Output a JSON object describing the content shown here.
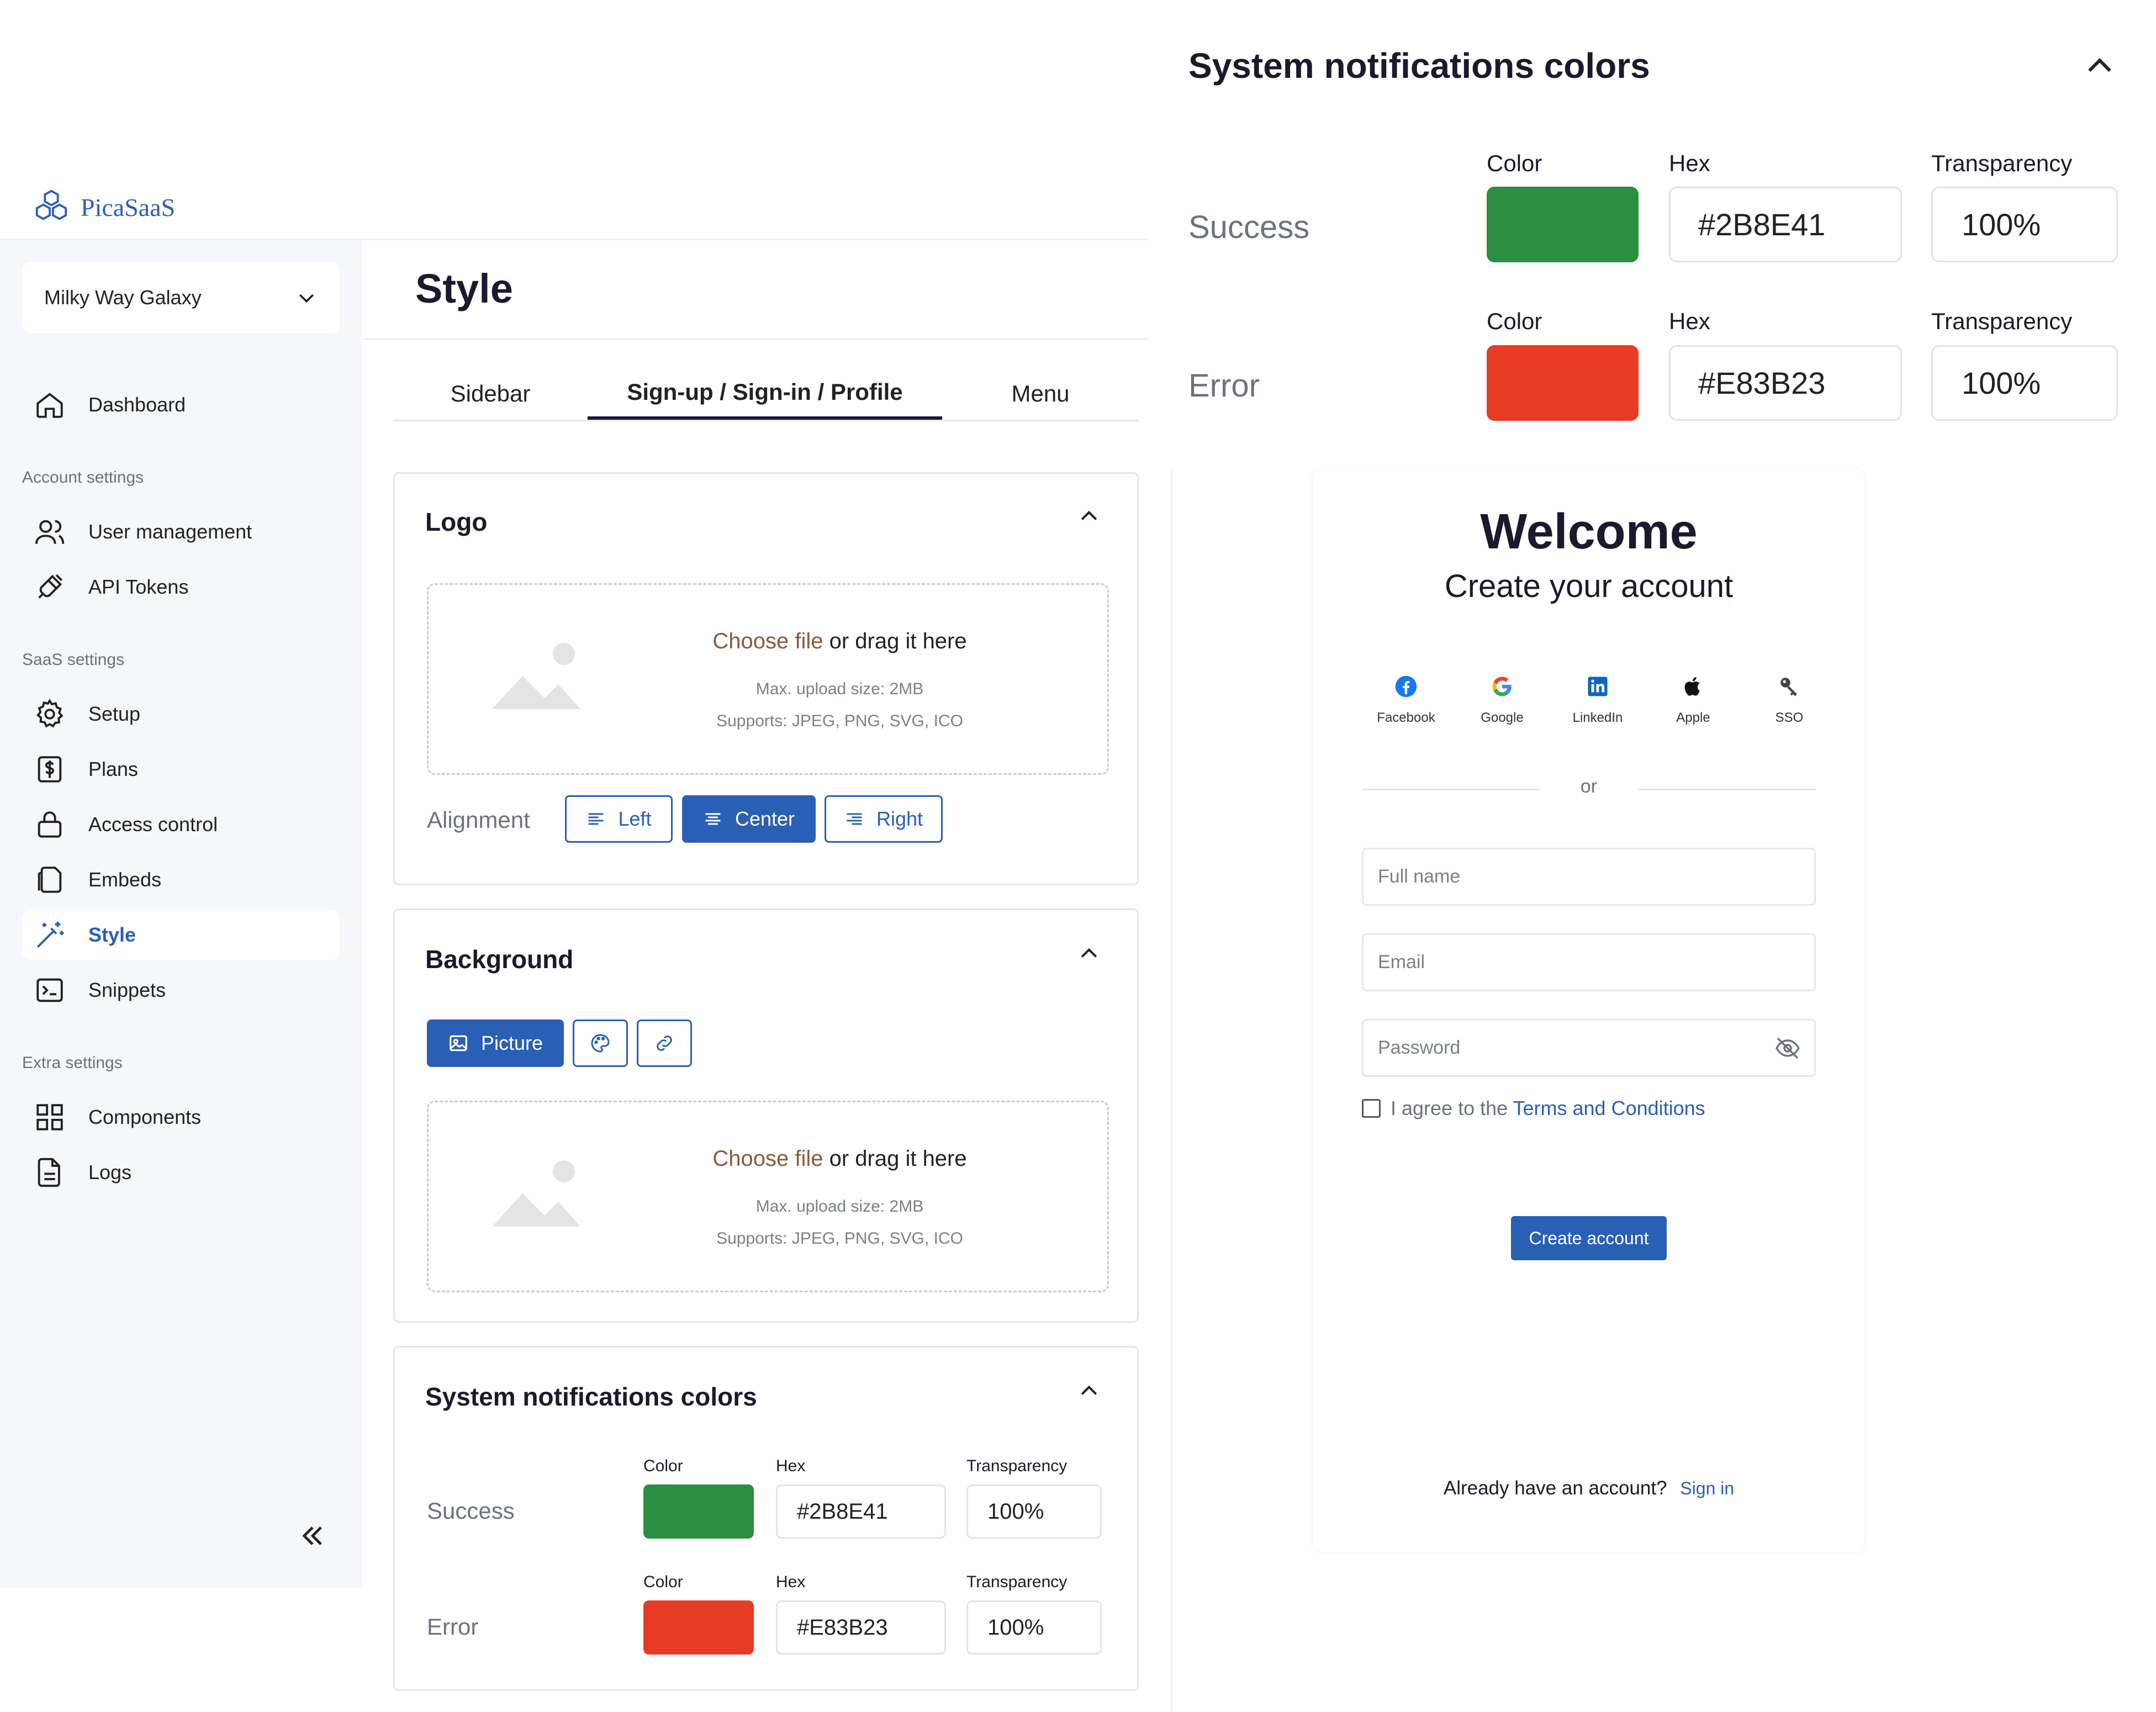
{
  "brand": {
    "name": "PicaSaaS"
  },
  "workspace": {
    "selected": "Milky Way Galaxy"
  },
  "sidebar": {
    "dashboard": "Dashboard",
    "sections": {
      "account": "Account settings",
      "saas": "SaaS settings",
      "extra": "Extra settings"
    },
    "items": {
      "user_management": "User management",
      "api_tokens": "API Tokens",
      "setup": "Setup",
      "plans": "Plans",
      "access_control": "Access control",
      "embeds": "Embeds",
      "style": "Style",
      "snippets": "Snippets",
      "components": "Components",
      "logs": "Logs"
    }
  },
  "page": {
    "title": "Style"
  },
  "tabs": {
    "sidebar": "Sidebar",
    "signup": "Sign-up / Sign-in / Profile",
    "menu": "Menu"
  },
  "logo_card": {
    "title": "Logo",
    "choose": "Choose file",
    "drag": " or drag it here",
    "max": "Max. upload size: 2MB",
    "supports": "Supports: JPEG, PNG, SVG, ICO",
    "alignment": "Alignment",
    "left": "Left",
    "center": "Center",
    "right": "Right"
  },
  "background_card": {
    "title": "Background",
    "picture": "Picture",
    "choose": "Choose file",
    "drag": " or drag it here",
    "max": "Max. upload size: 2MB",
    "supports": "Supports: JPEG, PNG, SVG, ICO"
  },
  "notifications": {
    "title": "System notifications colors",
    "color_label": "Color",
    "hex_label": "Hex",
    "transparency_label": "Transparency",
    "success": {
      "label": "Success",
      "hex": "#2B8E41",
      "transparency": "100%",
      "color": "#2B8E41"
    },
    "error": {
      "label": "Error",
      "hex": "#E83B23",
      "transparency": "100%",
      "color": "#E83B23"
    }
  },
  "preview": {
    "welcome": "Welcome",
    "subtitle": "Create your account",
    "socials": {
      "facebook": "Facebook",
      "google": "Google",
      "linkedin": "LinkedIn",
      "apple": "Apple",
      "sso": "SSO"
    },
    "or": "or",
    "full_name_placeholder": "Full name",
    "email_placeholder": "Email",
    "password_placeholder": "Password",
    "agree_prefix": "I agree to the ",
    "terms": "Terms and Conditions",
    "create_button": "Create account",
    "already": "Already have an account?",
    "sign_in": "Sign in"
  },
  "colors": {
    "accent": "#2A5FB6",
    "success": "#2B8E41",
    "error": "#E83B23"
  }
}
